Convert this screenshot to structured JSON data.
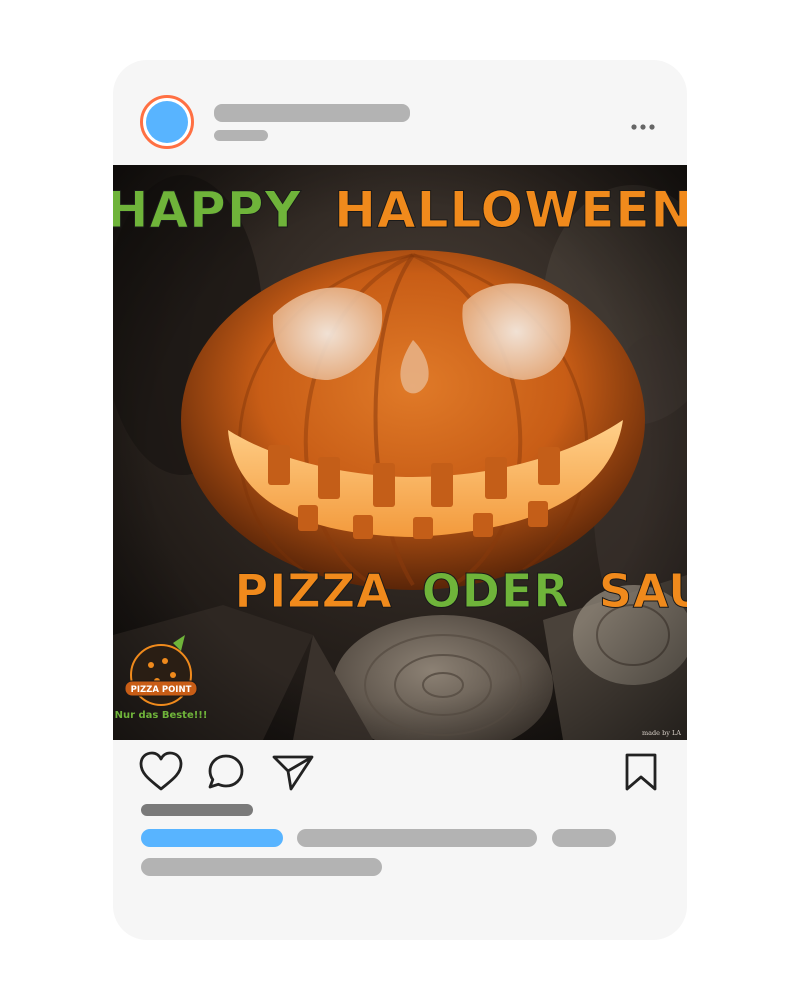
{
  "post": {
    "image": {
      "headline_word1": "HAPPY",
      "headline_word2": "HALLOWEEN",
      "slogan_word1": "PIZZA",
      "slogan_word2": "ODER",
      "slogan_word3": "SAURES!",
      "logo_text": "PIZZA POINT",
      "logo_tagline": "Nur das Beste!!!",
      "credit": "made by LA",
      "colors": {
        "green": "#6fb43a",
        "orange": "#f08a1c"
      }
    }
  },
  "icons": {
    "avatar": "avatar",
    "more": "more-dots-icon",
    "like": "heart-icon",
    "comment": "comment-icon",
    "share": "send-icon",
    "save": "bookmark-icon"
  },
  "colors": {
    "card_bg": "#f6f6f6",
    "skeleton": "#b3b3b3",
    "accent_blue": "#58b4ff",
    "avatar_ring": "#ff7043"
  }
}
